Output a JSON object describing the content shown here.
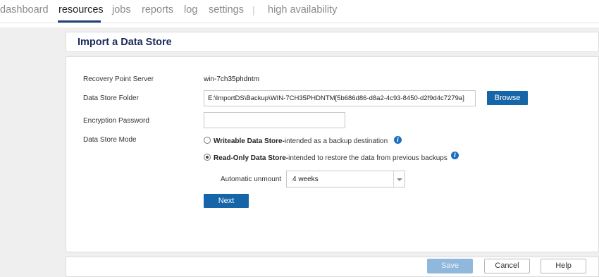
{
  "nav": {
    "items": [
      "dashboard",
      "resources",
      "jobs",
      "reports",
      "log",
      "settings"
    ],
    "separator": "|",
    "extra": "high availability",
    "active": "resources"
  },
  "page": {
    "title": "Import a Data Store"
  },
  "form": {
    "recovery_point_server": {
      "label": "Recovery Point Server",
      "value": "win-7ch35phdntm"
    },
    "data_store_folder": {
      "label": "Data Store Folder",
      "value": "E:\\ImportDS\\Backup\\WIN-7CH35PHDNTM[5b686d86-d8a2-4c93-8450-d2f9d4c7279a]",
      "browse_label": "Browse"
    },
    "encryption_password": {
      "label": "Encryption Password",
      "value": ""
    },
    "data_store_mode": {
      "label": "Data Store Mode",
      "options": [
        {
          "bold": "Writeable Data Store-",
          "text": "intended as a backup destination",
          "selected": false
        },
        {
          "bold": "Read-Only Data Store-",
          "text": "intended to restore the data from previous backups",
          "selected": true
        }
      ]
    },
    "automatic_unmount": {
      "label": "Automatic unmount",
      "value": "4 weeks"
    },
    "next_label": "Next"
  },
  "footer": {
    "save": "Save",
    "cancel": "Cancel",
    "help": "Help"
  },
  "colors": {
    "primary": "#1565a8",
    "nav_active_underline": "#1f3f77",
    "title": "#1a2a5a",
    "info_icon": "#1a6fc0"
  },
  "icons": [
    "info-icon",
    "chevron-down-icon"
  ]
}
